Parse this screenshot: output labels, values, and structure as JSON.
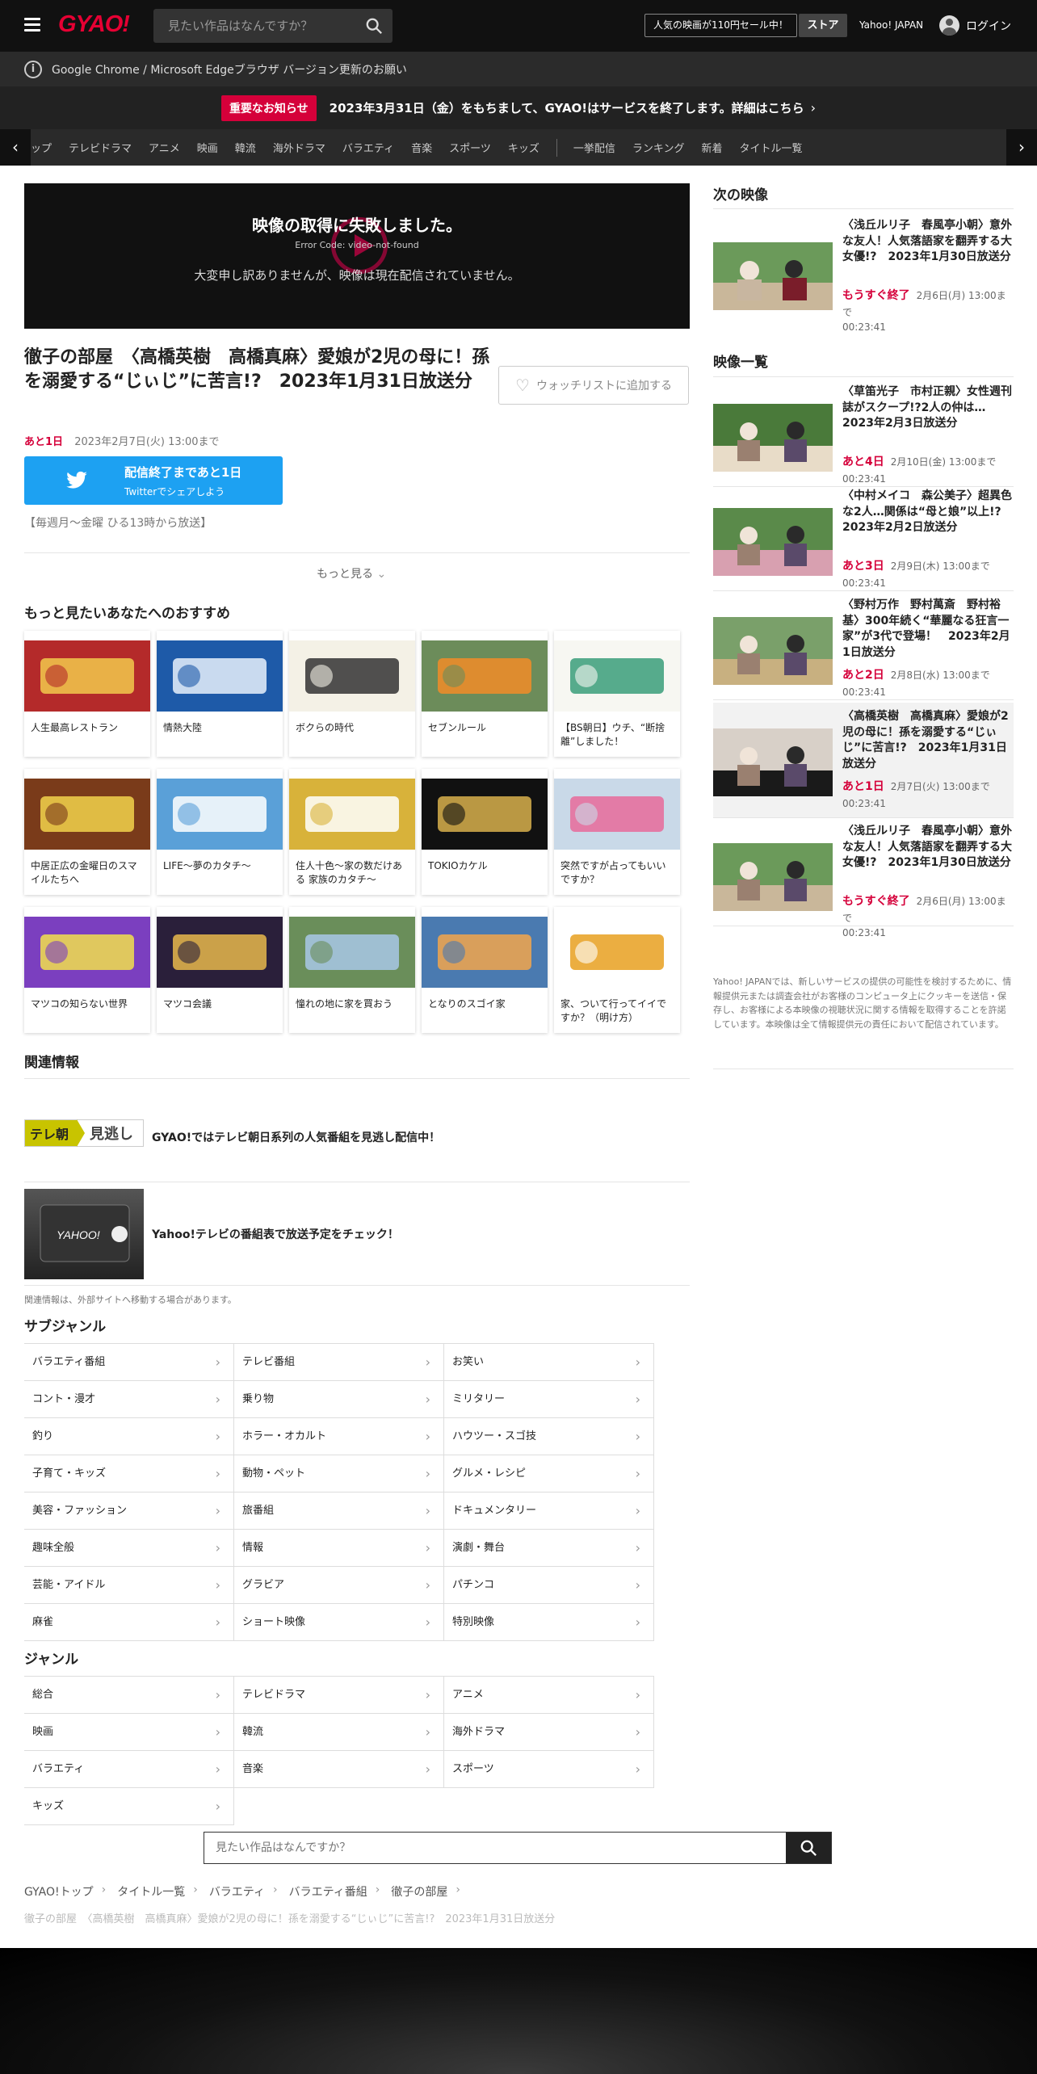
{
  "header": {
    "logo": "GYAO!",
    "search_placeholder": "見たい作品はなんですか？",
    "promo": "人気の映画が110円セール中！",
    "store": "ストア",
    "yahoo": "Yahoo! JAPAN",
    "login": "ログイン"
  },
  "browser_notice": "Google Chrome / Microsoft Edgeブラウザ バージョン更新のお願い",
  "important": {
    "badge": "重要なお知らせ",
    "message": "2023年3月31日（金）をもちまして、GYAO!はサービスを終了します。詳細はこちら"
  },
  "catnav": {
    "items_a": [
      "ップ",
      "テレビドラマ",
      "アニメ",
      "映画",
      "韓流",
      "海外ドラマ",
      "バラエティ",
      "音楽",
      "スポーツ",
      "キッズ"
    ],
    "items_b": [
      "一挙配信",
      "ランキング",
      "新着",
      "タイトル一覧"
    ]
  },
  "player": {
    "error_title": "映像の取得に失敗しました。",
    "error_code": "Error Code: video-not-found",
    "error_message": "大変申し訳ありませんが、映像は現在配信されていません。"
  },
  "episode": {
    "title": "徹子の部屋　〈高橋英樹　高橋真麻〉愛娘が2児の母に！孫を溺愛する“じぃじ”に苦言!?　2023年1月31日放送分",
    "watchlist": "ウォッチリストに追加する",
    "remain": "あと1日",
    "deadline": "2023年2月7日(火) 13:00まで",
    "twitter_line1": "配信終了まであと1日",
    "twitter_line2": "Twitterでシェアしよう",
    "schedule": "【毎週月～金曜 ひる13時から放送】",
    "more": "もっと見る"
  },
  "recommend": {
    "title": "もっと見たいあなたへのおすすめ",
    "items": [
      "人生最高レストラン",
      "情熱大陸",
      "ボクらの時代",
      "セブンルール",
      "【BS朝日】ウチ、“断捨離”しました！",
      "中居正広の金曜日のスマイルたちへ",
      "LIFE～夢のカタチ～",
      "住人十色～家の数だけある 家族のカタチ～",
      "TOKIOカケル",
      "突然ですが占ってもいいですか？",
      "マツコの知らない世界",
      "マツコ会議",
      "憧れの地に家を買おう",
      "となりのスゴイ家",
      "家、ついて行ってイイですか？（明け方）"
    ]
  },
  "related": {
    "title": "関連情報",
    "items": [
      "GYAO!ではテレビ朝日系列の人気番組を見逃し配信中！",
      "Yahoo!テレビの番組表で放送予定をチェック！"
    ],
    "tv_asahi_logo_a": "テレ朝",
    "tv_asahi_logo_b": "見逃し",
    "note": "関連情報は、外部サイトへ移動する場合があります。"
  },
  "subgenre": {
    "title": "サブジャンル",
    "items": [
      "バラエティ番組",
      "テレビ番組",
      "お笑い",
      "コント・漫才",
      "乗り物",
      "ミリタリー",
      "釣り",
      "ホラー・オカルト",
      "ハウツー・スゴ技",
      "子育て・キッズ",
      "動物・ペット",
      "グルメ・レシピ",
      "美容・ファッション",
      "旅番組",
      "ドキュメンタリー",
      "趣味全般",
      "情報",
      "演劇・舞台",
      "芸能・アイドル",
      "グラビア",
      "パチンコ",
      "麻雀",
      "ショート映像",
      "特別映像"
    ]
  },
  "genre": {
    "title": "ジャンル",
    "items": [
      "総合",
      "テレビドラマ",
      "アニメ",
      "映画",
      "韓流",
      "海外ドラマ",
      "バラエティ",
      "音楽",
      "スポーツ",
      "キッズ"
    ]
  },
  "bottom_search_placeholder": "見たい作品はなんですか？",
  "breadcrumb": {
    "items": [
      "GYAO!トップ",
      "タイトル一覧",
      "バラエティ",
      "バラエティ番組",
      "徹子の部屋"
    ],
    "current": "徹子の部屋　〈高橋英樹　高橋真麻〉愛娘が2児の母に！孫を溺愛する“じぃじ”に苦言!?　2023年1月31日放送分"
  },
  "next": {
    "title": "次の映像",
    "item": {
      "title": "〈浅丘ルリ子　春風亭小朝〉意外な友人！人気落語家を翻弄する大女優!?　2023年1月30日放送分",
      "remain": "もうすぐ終了",
      "deadline": "2月6日(月) 13:00まで",
      "duration": "00:23:41"
    }
  },
  "list": {
    "title": "映像一覧",
    "items": [
      {
        "title": "〈草笛光子　市村正親〉女性週刊誌がスクープ!?2人の仲は…　2023年2月3日放送分",
        "remain": "あと4日",
        "deadline": "2月10日(金) 13:00まで",
        "duration": "00:23:41"
      },
      {
        "title": "〈中村メイコ　森公美子〉超異色な2人…関係は“母と娘”以上!?　2023年2月2日放送分",
        "remain": "あと3日",
        "deadline": "2月9日(木) 13:00まで",
        "duration": "00:23:41"
      },
      {
        "title": "〈野村万作　野村萬斎　野村裕基〉300年続く“華麗なる狂言一家”が3代で登場！　2023年2月1日放送分",
        "remain": "あと2日",
        "deadline": "2月8日(水) 13:00まで",
        "duration": "00:23:41"
      },
      {
        "title": "〈高橋英樹　高橋真麻〉愛娘が2児の母に！孫を溺愛する“じぃじ”に苦言!?　2023年1月31日放送分",
        "remain": "あと1日",
        "deadline": "2月7日(火) 13:00まで",
        "duration": "00:23:41"
      },
      {
        "title": "〈浅丘ルリ子　春風亭小朝〉意外な友人！人気落語家を翻弄する大女優!?　2023年1月30日放送分",
        "remain": "もうすぐ終了",
        "deadline": "2月6日(月) 13:00まで",
        "duration": "00:23:41"
      }
    ]
  },
  "side_note": "Yahoo! JAPANでは、新しいサービスの提供の可能性を検討するために、情報提供元または調査会社がお客様のコンピュータ上にクッキーを送信・保存し、お客様による本映像の視聴状況に関する情報を取得することを許諾しています。本映像は全て情報提供元の責任において配信されています。",
  "colors": {
    "accent": "#d5003a",
    "twitter": "#1da1f2",
    "header_bg": "#111111"
  }
}
